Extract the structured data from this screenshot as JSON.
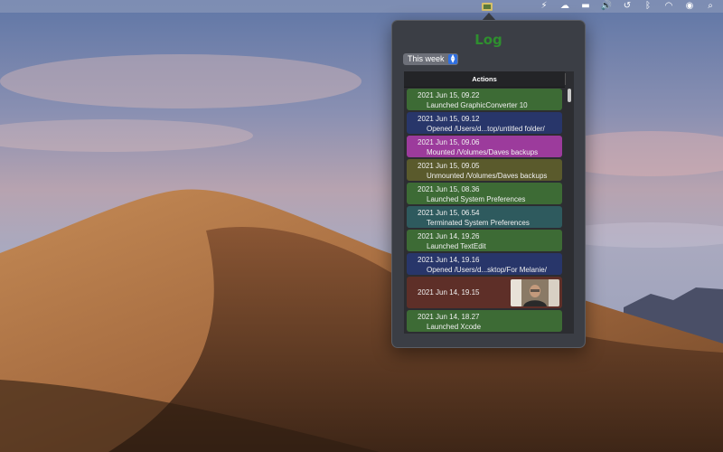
{
  "menubar": {
    "icons": [
      "app-icon",
      "bolt-icon",
      "cloud-icon",
      "folder-icon",
      "volume-icon",
      "time-machine-icon",
      "bluetooth-icon",
      "wifi-icon",
      "user-icon",
      "search-icon"
    ]
  },
  "popover": {
    "title": "Log",
    "period": "This week",
    "column_header": "Actions",
    "entries": [
      {
        "time": "2021 Jun 15, 09.22",
        "action": "Launched GraphicConverter 10",
        "color": "#3d6b35"
      },
      {
        "time": "2021 Jun 15, 09.12",
        "action": "Opened /Users/d...top/untitled folder/",
        "color": "#28366a"
      },
      {
        "time": "2021 Jun 15, 09.06",
        "action": "Mounted /Volumes/Daves backups",
        "color": "#9c3b9c"
      },
      {
        "time": "2021 Jun 15, 09.05",
        "action": "Unmounted /Volumes/Daves backups",
        "color": "#5a5a2c"
      },
      {
        "time": "2021 Jun 15, 08.36",
        "action": "Launched System Preferences",
        "color": "#3d6b35"
      },
      {
        "time": "2021 Jun 15, 06.54",
        "action": "Terminated System Preferences",
        "color": "#2e5a5e"
      },
      {
        "time": "2021 Jun 14, 19.26",
        "action": "Launched TextEdit",
        "color": "#3d6b35"
      },
      {
        "time": "2021 Jun 14, 19.16",
        "action": "Opened /Users/d...sktop/For Melanie/",
        "color": "#28366a"
      },
      {
        "time": "2021 Jun 14, 19.15",
        "action": "",
        "color": "#5e2f28"
      },
      {
        "time": "2021 Jun 14, 18.27",
        "action": "Launched Xcode",
        "color": "#3d6b35"
      }
    ]
  }
}
